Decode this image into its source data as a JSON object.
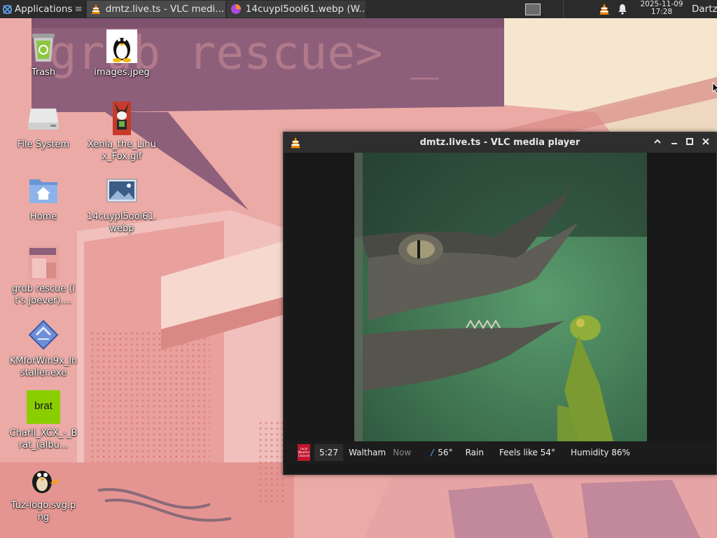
{
  "panel": {
    "applications_label": "Applications",
    "tasks": [
      {
        "label": "dmtz.live.ts - VLC medi...",
        "icon": "vlc-icon",
        "active": true
      },
      {
        "label": "14cuypl5ool61.webp (W...",
        "icon": "firefox-icon",
        "active": false
      }
    ],
    "clock_date": "2025-11-09",
    "clock_time": "17:28",
    "user": "Dartz"
  },
  "wallpaper": {
    "text": "grub rescue> _"
  },
  "desktop_icons": [
    {
      "label": "Trash",
      "icon": "trash-icon"
    },
    {
      "label": "images.jpeg",
      "icon": "tux-image-icon"
    },
    {
      "label": "File System",
      "icon": "drive-icon"
    },
    {
      "label": "Xenia_the_Linux_Fox.gif",
      "icon": "fox-image-icon"
    },
    {
      "label": "Home",
      "icon": "home-folder-icon"
    },
    {
      "label": "14cuypl5ool61.webp",
      "icon": "image-file-icon"
    },
    {
      "label": "grub rescue (it's joever)....",
      "icon": "wallpaper-thumb-icon"
    },
    {
      "label": "KMforWin9x_Installer.exe",
      "icon": "exe-icon"
    },
    {
      "label": "Charli_XCX_-_Brat_(albu...",
      "icon": "brat-cover-icon"
    },
    {
      "label": "Tuz-logo.svg.png",
      "icon": "tuz-logo-icon"
    }
  ],
  "brat_cover_text": "brat",
  "vlc": {
    "title": "dmtz.live.ts - VLC media player",
    "ticker": {
      "brand": "Local Weather Channel",
      "time": "5:27",
      "city": "Waltham",
      "now": "Now",
      "temp": "56°",
      "condition": "Rain",
      "feels": "Feels like 54°",
      "humidity": "Humidity 86%"
    }
  }
}
